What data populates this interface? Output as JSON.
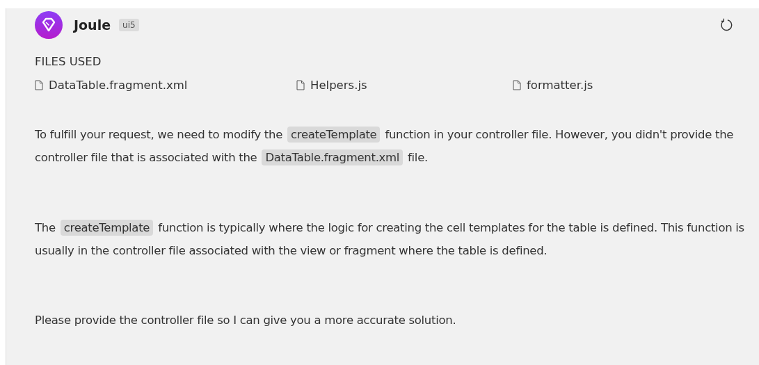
{
  "assistant": {
    "name": "Joule",
    "badge": "ui5"
  },
  "files_used": {
    "heading": "FILES USED",
    "files": [
      "DataTable.fragment.xml",
      "Helpers.js",
      "formatter.js"
    ]
  },
  "paragraphs": [
    [
      {
        "kind": "text",
        "text": "To fulfill your request, we need to modify the "
      },
      {
        "kind": "code",
        "text": "createTemplate"
      },
      {
        "kind": "text",
        "text": " function in your controller file. However, you didn't provide the controller file that is associated with the "
      },
      {
        "kind": "code",
        "text": "DataTable.fragment.xml"
      },
      {
        "kind": "text",
        "text": " file."
      }
    ],
    [
      {
        "kind": "text",
        "text": "The "
      },
      {
        "kind": "code",
        "text": "createTemplate"
      },
      {
        "kind": "text",
        "text": " function is typically where the logic for creating the cell templates for the table is defined. This function is usually in the controller file associated with the view or fragment where the table is defined."
      }
    ],
    [
      {
        "kind": "text",
        "text": "Please provide the controller file so I can give you a more accurate solution."
      }
    ]
  ]
}
